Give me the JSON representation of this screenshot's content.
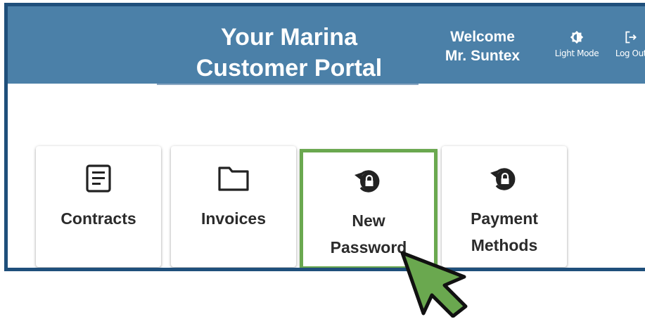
{
  "header": {
    "title_line1": "Your Marina",
    "title_line2": "Customer Portal",
    "welcome_line1": "Welcome",
    "welcome_line2": "Mr. Suntex",
    "light_mode": {
      "label": "Light Mode",
      "icon": "brightness-icon"
    },
    "log_out": {
      "label": "Log Out",
      "icon": "logout-icon"
    }
  },
  "cards": [
    {
      "label": "Contracts",
      "icon": "document-icon"
    },
    {
      "label": "Invoices",
      "icon": "folder-icon"
    },
    {
      "label": "New\nPassword",
      "icon": "lock-reset-icon",
      "highlighted": true
    },
    {
      "label": "Payment\nMethods",
      "icon": "lock-reset-icon"
    }
  ],
  "colors": {
    "header_bg": "#4b80a8",
    "frame_border": "#1f4f7b",
    "highlight": "#6aa84f",
    "cursor_fill": "#6aa84f"
  },
  "annotation": {
    "icon": "pointer-cursor-icon"
  }
}
